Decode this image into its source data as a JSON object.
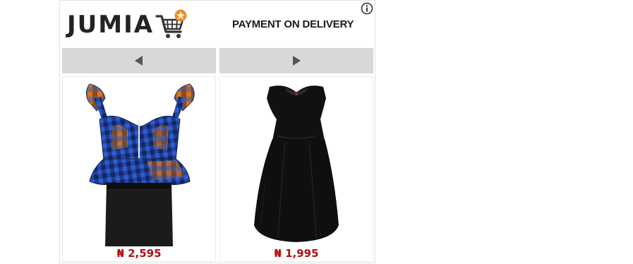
{
  "brand": {
    "logo_text": "JUMIA",
    "tagline": "PAYMENT ON DELIVERY",
    "logo_icon": "shopping-cart-star-icon",
    "accent_color": "#f68b1e"
  },
  "ad": {
    "info_icon": "info-icon"
  },
  "nav": {
    "prev_icon": "triangle-left-icon",
    "next_icon": "triangle-right-icon"
  },
  "products": [
    {
      "name": "plaid-peplum-top-skirt",
      "price": "₦ 2,595"
    },
    {
      "name": "black-dress",
      "price": "₦ 1,995"
    }
  ],
  "colors": {
    "price": "#b20f14",
    "nav_bg": "#d8d8d8"
  }
}
